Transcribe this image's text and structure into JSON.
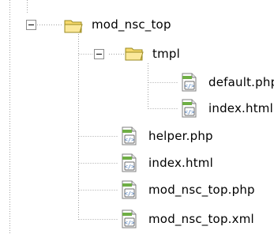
{
  "tree": {
    "nodes": [
      {
        "label": "mod_nsc_top",
        "icon": "folder-open-icon",
        "expanded": true
      },
      {
        "label": "tmpl",
        "icon": "folder-open-icon",
        "expanded": true
      },
      {
        "label": "default.php",
        "icon": "php-file-icon"
      },
      {
        "label": "index.html",
        "icon": "html-file-icon"
      },
      {
        "label": "helper.php",
        "icon": "php-file-icon"
      },
      {
        "label": "index.html",
        "icon": "html-file-icon"
      },
      {
        "label": "mod_nsc_top.php",
        "icon": "php-file-icon"
      },
      {
        "label": "mod_nsc_top.xml",
        "icon": "xml-file-icon"
      }
    ],
    "colors": {
      "dotted_line": "#a0a0a0",
      "folder_fill": "#f6d96c",
      "folder_stroke": "#9a8a20",
      "file_green": "#5a9a3a",
      "file_blue": "#3c6fb0"
    }
  }
}
